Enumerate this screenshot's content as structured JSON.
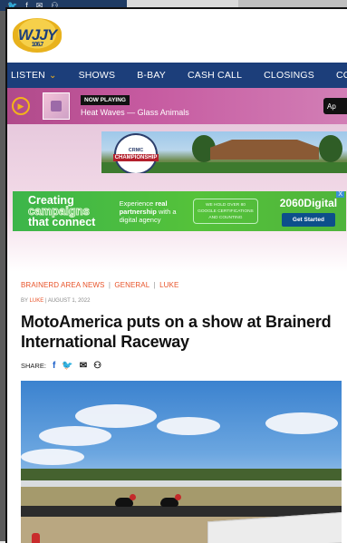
{
  "background_bar": {
    "icons": [
      "twitter-icon",
      "facebook-icon",
      "email-icon",
      "link-icon"
    ]
  },
  "station": {
    "logo_text": "WJJY",
    "logo_sub": "106.7",
    "brand_colors": {
      "navy": "#1c3e7a",
      "gold": "#f3b31b",
      "accent_orange": "#e8542a"
    }
  },
  "nav": {
    "items": [
      {
        "label": "LISTEN",
        "dropdown": true
      },
      {
        "label": "SHOWS"
      },
      {
        "label": "B-BAY"
      },
      {
        "label": "CASH CALL"
      },
      {
        "label": "CLOSINGS"
      },
      {
        "label": "COMMUNITY"
      }
    ]
  },
  "player": {
    "now_playing_badge": "NOW PLAYING",
    "track": "Heat Waves — Glass Animals",
    "app_badge": "Ap"
  },
  "ads": {
    "crmc": {
      "seal_text": "CRMC",
      "seal_ribbon": "CHAMPIONSHIP"
    },
    "digital": {
      "line1": "Creating",
      "line2": "campaigns",
      "line3": "that connect",
      "copy_1": "Experience ",
      "copy_bold": "real partnership",
      "copy_2": " with a digital agency",
      "cert": "WE HOLD OVER 80 GOOGLE CERTIFICATIONS AND COUNTING",
      "brand": "2060Digital",
      "cta": "Get Started",
      "close": "X"
    }
  },
  "article": {
    "categories": [
      "BRAINERD AREA NEWS",
      "GENERAL",
      "LUKE"
    ],
    "by": "BY",
    "author": "LUKE",
    "date": "AUGUST 1, 2022",
    "title": "MotoAmerica puts on a show at Brainerd International Raceway",
    "share_label": "SHARE:",
    "share_icons": [
      "facebook-icon",
      "twitter-icon",
      "email-icon",
      "link-icon"
    ]
  }
}
